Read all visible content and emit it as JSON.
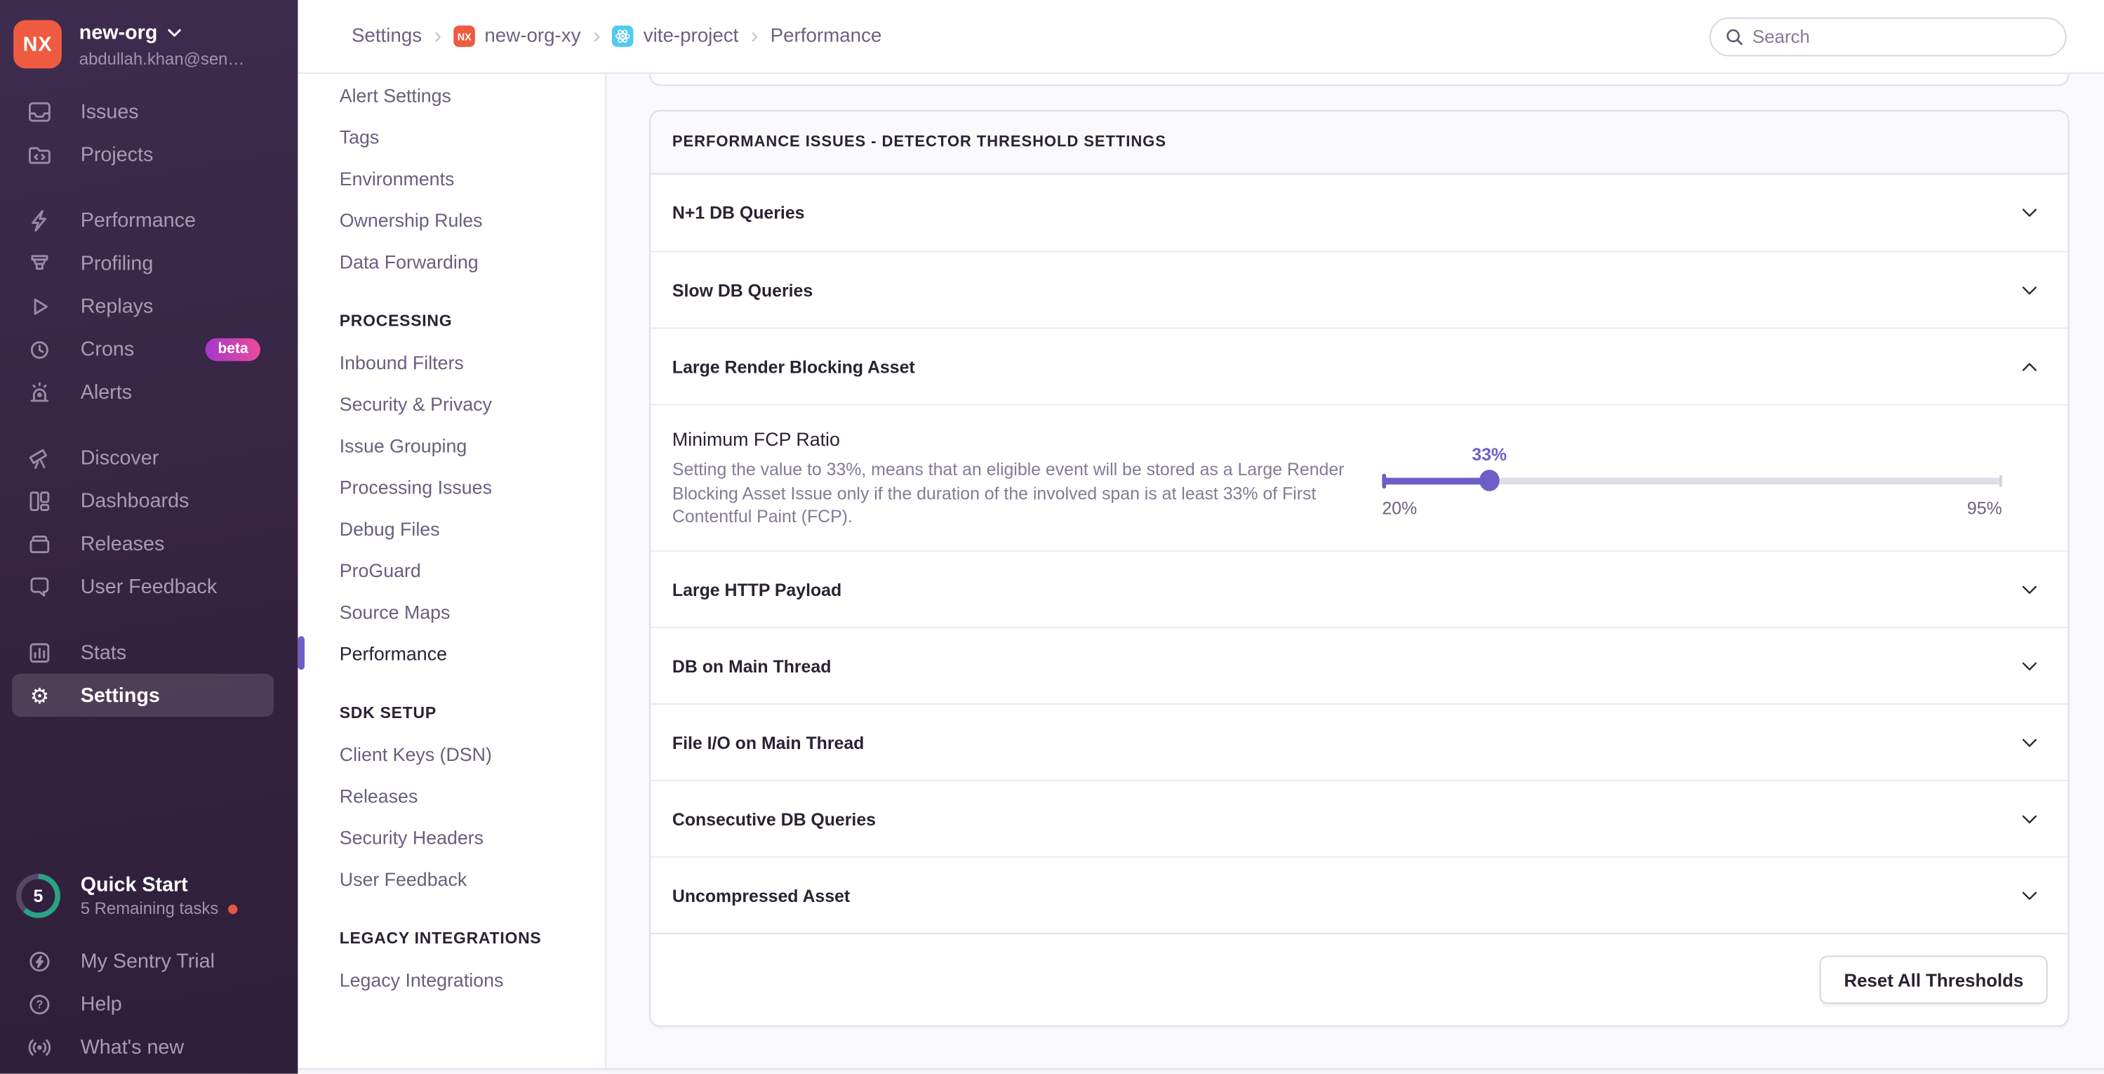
{
  "colors": {
    "accent_purple": "#6C5FC7",
    "org_badge_orange": "#EE5B40",
    "react_badge_blue": "#53C9EF",
    "progress_teal": "#2BA185",
    "notification_dot_orange": "#E8573F"
  },
  "sidebar": {
    "org": {
      "initials": "NX",
      "name": "new-org",
      "email": "abdullah.khan@sen…"
    },
    "groups": [
      {
        "items": [
          {
            "label": "Issues"
          },
          {
            "label": "Projects"
          }
        ]
      },
      {
        "items": [
          {
            "label": "Performance"
          },
          {
            "label": "Profiling"
          },
          {
            "label": "Replays"
          },
          {
            "label": "Crons",
            "badge": "beta"
          },
          {
            "label": "Alerts"
          }
        ]
      },
      {
        "items": [
          {
            "label": "Discover"
          },
          {
            "label": "Dashboards"
          },
          {
            "label": "Releases"
          },
          {
            "label": "User Feedback"
          }
        ]
      },
      {
        "items": [
          {
            "label": "Stats"
          },
          {
            "label": "Settings"
          }
        ]
      }
    ],
    "quick_start": {
      "count": "5",
      "title": "Quick Start",
      "subtitle": "5 Remaining tasks"
    },
    "footer_items": [
      {
        "label": "My Sentry Trial"
      },
      {
        "label": "Help"
      },
      {
        "label": "What's new"
      }
    ]
  },
  "topbar": {
    "breadcrumbs": [
      {
        "label": "Settings"
      },
      {
        "label": "new-org-xy",
        "badge": "NX"
      },
      {
        "label": "vite-project"
      },
      {
        "label": "Performance"
      }
    ],
    "search_placeholder": "Search"
  },
  "settings_nav": {
    "top_items": [
      "Alert Settings",
      "Tags",
      "Environments",
      "Ownership Rules",
      "Data Forwarding"
    ],
    "sections": [
      {
        "header": "PROCESSING",
        "items": [
          "Inbound Filters",
          "Security & Privacy",
          "Issue Grouping",
          "Processing Issues",
          "Debug Files",
          "ProGuard",
          "Source Maps",
          "Performance"
        ],
        "active_item": "Performance"
      },
      {
        "header": "SDK SETUP",
        "items": [
          "Client Keys (DSN)",
          "Releases",
          "Security Headers",
          "User Feedback"
        ]
      },
      {
        "header": "LEGACY INTEGRATIONS",
        "items": [
          "Legacy Integrations"
        ]
      }
    ]
  },
  "main": {
    "panel_title": "PERFORMANCE ISSUES - DETECTOR THRESHOLD SETTINGS",
    "rows": [
      "N+1 DB Queries",
      "Slow DB Queries",
      "Large Render Blocking Asset",
      "Large HTTP Payload",
      "DB on Main Thread",
      "File I/O on Main Thread",
      "Consecutive DB Queries",
      "Uncompressed Asset"
    ],
    "expanded": {
      "row": "Large Render Blocking Asset",
      "title": "Minimum FCP Ratio",
      "description": "Setting the value to 33%, means that an eligible event will be stored as a Large Render Blocking Asset Issue only if the duration of the involved span is at least 33% of First Contentful Paint (FCP).",
      "slider": {
        "value_label": "33%",
        "min_label": "20%",
        "max_label": "95%",
        "percent": 17.3
      }
    },
    "reset_button_label": "Reset All Thresholds"
  }
}
